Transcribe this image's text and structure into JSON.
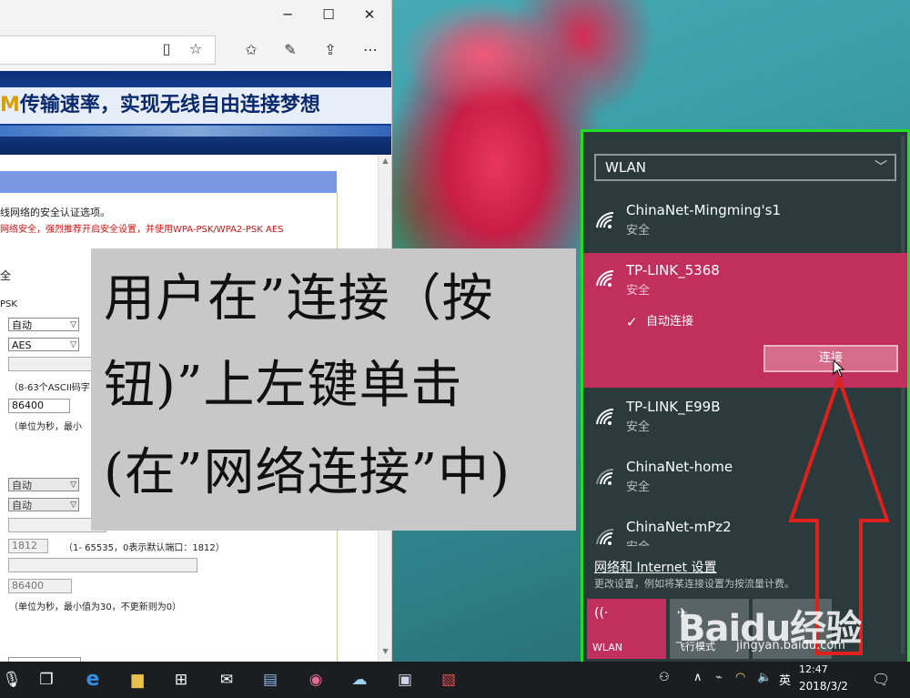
{
  "browser": {
    "banner_text": "M传输速率，实现无线自由连接梦想",
    "banner_highlight": "M",
    "banner_rest": "传输速率，实现无线自由连接梦想",
    "desc_line1": "线网络的安全认证选项。",
    "desc_line2": "网络安全，强烈推荐开启安全设置，并使用WPA-PSK/WPA2-PSK AES",
    "label_security": "全",
    "label_psk": "PSK",
    "select_auth": "自动",
    "select_encrypt": "AES",
    "key_hint": "（8-63个ASCII码字",
    "renew_value": "86400",
    "renew_hint": "（单位为秒，最小",
    "select_auth2": "自动",
    "select_encrypt2": "自动",
    "radius_port": "1812",
    "radius_port_hint": "（1- 65535，0表示默认端口：1812）",
    "renew_value2": "86400",
    "renew_hint2": "（单位为秒，最小值为30，不更新则为0）"
  },
  "caption": {
    "line1": "用户在”连接（按",
    "line2": "钮)”上左键单击",
    "line3": "(在”网络连接”中)"
  },
  "wlan": {
    "selector": "WLAN",
    "networks": [
      {
        "name": "ChinaNet-Mingming's1",
        "security": "安全"
      },
      {
        "name": "TP-LINK_5368",
        "security": "安全"
      },
      {
        "name": "TP-LINK_E99B",
        "security": "安全"
      },
      {
        "name": "ChinaNet-home",
        "security": "安全"
      },
      {
        "name": "ChinaNet-mPz2",
        "security": "安全"
      }
    ],
    "auto_connect_label": "自动连接",
    "connect_label": "连接",
    "settings_link": "网络和 Internet 设置",
    "settings_desc": "更改设置，例如将某连接设置为按流量计费。",
    "tiles": [
      {
        "label": "WLAN",
        "active": true
      },
      {
        "label": "飞行模式",
        "active": false
      },
      {
        "label": "",
        "active": false
      }
    ]
  },
  "watermark": {
    "logo": "Baidu经验",
    "url": "jingyan.baidu.com"
  },
  "taskbar": {
    "ime": "英",
    "time": "12:47",
    "date": "2018/3/2"
  },
  "colors": {
    "selected_network": "#c12f5e",
    "flyout_bg": "#2a3a3d",
    "highlight_border": "#22e021",
    "arrow": "#e0201a"
  }
}
